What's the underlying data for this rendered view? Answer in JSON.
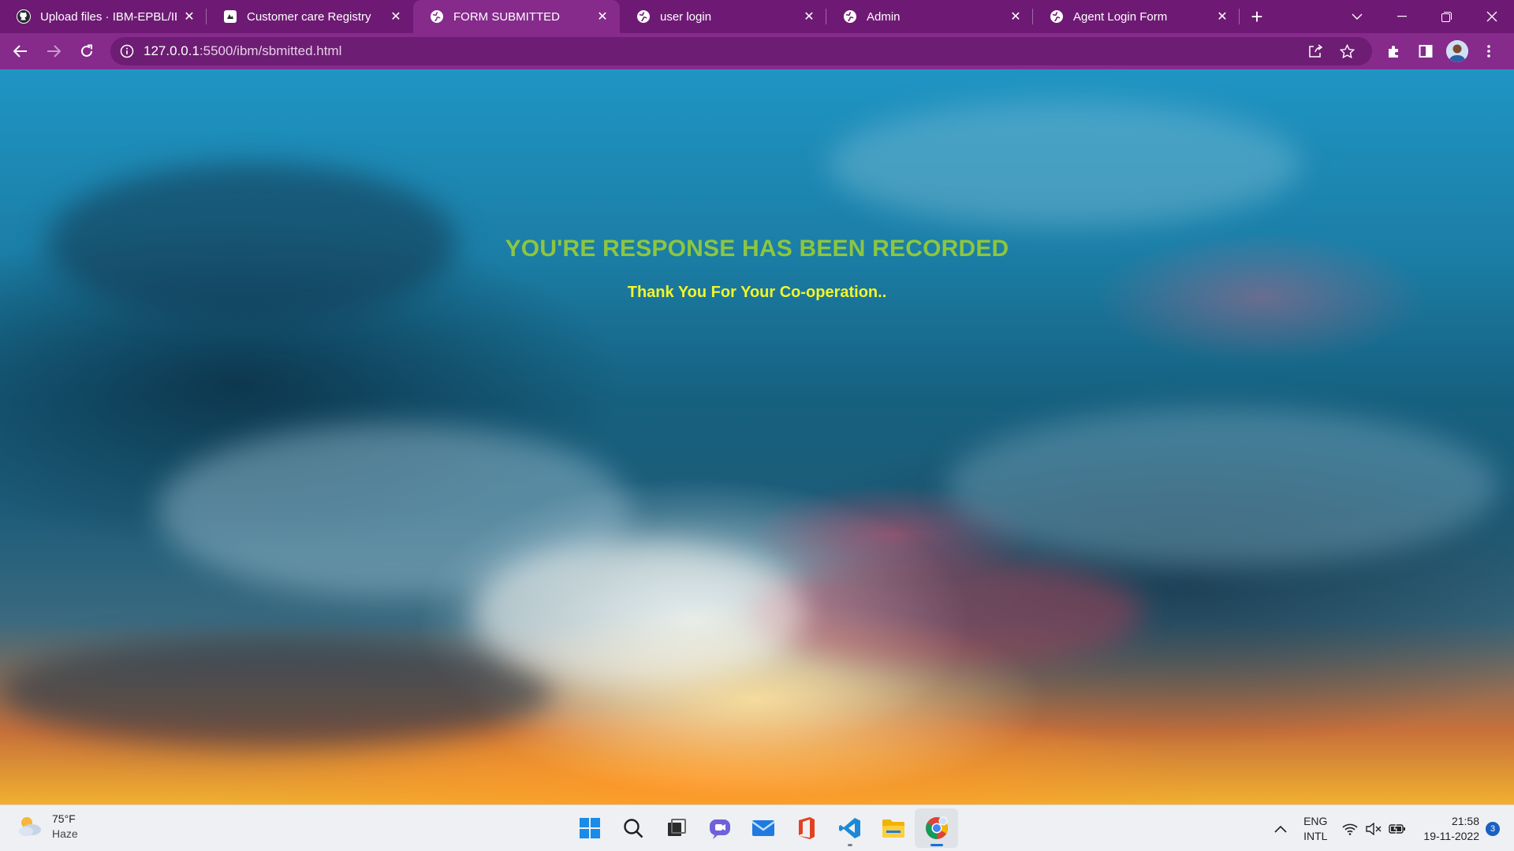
{
  "browser": {
    "tabs": [
      {
        "title": "Upload files · IBM-EPBL/IBM",
        "icon": "github-icon",
        "active": false
      },
      {
        "title": "Customer care Registry",
        "icon": "site-logo-icon",
        "active": false
      },
      {
        "title": "FORM SUBMITTED",
        "icon": "globe-icon",
        "active": true
      },
      {
        "title": "user login",
        "icon": "globe-icon",
        "active": false
      },
      {
        "title": "Admin",
        "icon": "globe-icon",
        "active": false
      },
      {
        "title": "Agent Login Form",
        "icon": "globe-icon",
        "active": false
      }
    ],
    "url_host": "127.0.0.1",
    "url_path": ":5500/ibm/sbmitted.html",
    "colors": {
      "tabbar": "#6e1a74",
      "toolbar": "#862a8c"
    }
  },
  "page": {
    "headline": "YOU'RE RESPONSE HAS BEEN RECORDED",
    "subline": "Thank You For Your Co-operation..",
    "headline_color": "#8dc63f",
    "subline_color": "#f3f52a"
  },
  "taskbar": {
    "weather_temp": "75°F",
    "weather_cond": "Haze",
    "apps": [
      "windows-start-icon",
      "search-icon",
      "task-view-icon",
      "teams-chat-icon",
      "mail-icon",
      "office-icon",
      "vscode-icon",
      "file-explorer-icon",
      "chrome-icon"
    ],
    "lang_line1": "ENG",
    "lang_line2": "INTL",
    "time": "21:58",
    "date": "19-11-2022",
    "notifications": "3"
  }
}
